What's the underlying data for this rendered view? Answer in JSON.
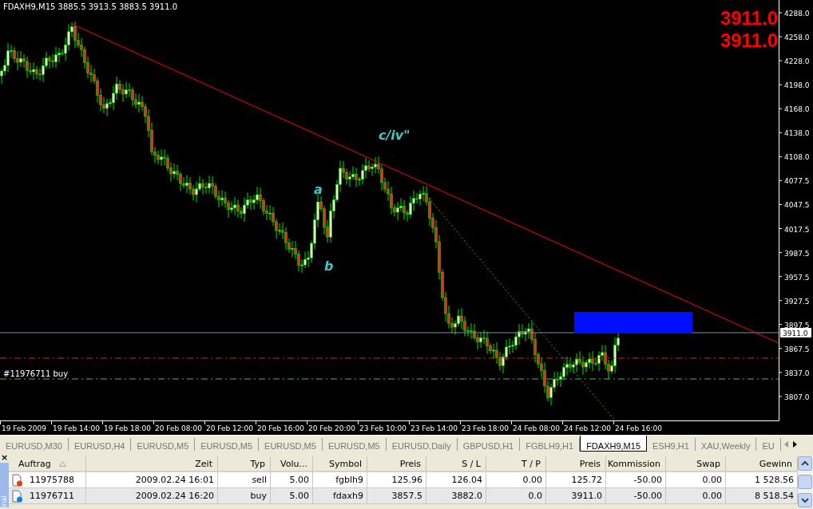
{
  "chart": {
    "header": {
      "symbol": "FDAXH9,M15",
      "ohlc": "3885.5 3913.5 3883.5 3911.0"
    },
    "bid_ask": [
      "3911.0",
      "3911.0"
    ],
    "price_ticks": [
      "4288.0",
      "4258.0",
      "4228.0",
      "4198.0",
      "4168.0",
      "4138.0",
      "4108.0",
      "4077.5",
      "4047.5",
      "4017.5",
      "3987.5",
      "3957.5",
      "3927.5",
      "3897.5",
      "3867.5",
      "3837.0",
      "3807.0"
    ],
    "current_price": "3911.0",
    "time_labels": [
      "19 Feb 2009",
      "19 Feb 14:00",
      "19 Feb 18:00",
      "20 Feb 08:00",
      "20 Feb 12:00",
      "20 Feb 16:00",
      "20 Feb 20:00",
      "23 Feb 10:00",
      "23 Feb 14:00",
      "23 Feb 18:00",
      "24 Feb 08:00",
      "24 Feb 12:00",
      "24 Feb 16:00"
    ],
    "wave_labels": [
      "a",
      "b",
      "c/iv\""
    ],
    "order_line_label": "#11976711 buy"
  },
  "tabs": [
    {
      "label": "EURUSD,M30",
      "selected": false
    },
    {
      "label": "EURUSD,H4",
      "selected": false
    },
    {
      "label": "EURUSD,M5",
      "selected": false
    },
    {
      "label": "EURUSD,M5",
      "selected": false
    },
    {
      "label": "EURUSD,M5",
      "selected": false
    },
    {
      "label": "EURUSD,M5",
      "selected": false
    },
    {
      "label": "EURUSD,Daily",
      "selected": false
    },
    {
      "label": "GBPUSD,H1",
      "selected": false
    },
    {
      "label": "FGBLH9,H1",
      "selected": false
    },
    {
      "label": "FDAXH9,M15",
      "selected": true
    },
    {
      "label": "ESH9,H1",
      "selected": false
    },
    {
      "label": "XAU,Weekly",
      "selected": false
    },
    {
      "label": "EU",
      "selected": false
    }
  ],
  "terminal": {
    "close": "×",
    "side_title": "inal",
    "columns": [
      "Auftrag",
      "Zeit",
      "Typ",
      "Volu...",
      "Symbol",
      "Preis",
      "S / L",
      "T / P",
      "Preis",
      "Kommission",
      "Swap",
      "Gewinn"
    ],
    "rows": [
      {
        "kind": "sell",
        "selected": false,
        "cells": [
          "11975788",
          "2009.02.24 16:01",
          "sell",
          "5.00",
          "fgblh9",
          "125.96",
          "126.04",
          "0.00",
          "125.72",
          "-50.00",
          "0.00",
          "1 528.56"
        ]
      },
      {
        "kind": "buy",
        "selected": true,
        "cells": [
          "11976711",
          "2009.02.24 16:20",
          "buy",
          "5.00",
          "fdaxh9",
          "3857.5",
          "3882.0",
          "0.0",
          "3911.0",
          "-50.00",
          "0.00",
          "8 518.54"
        ]
      }
    ]
  }
}
